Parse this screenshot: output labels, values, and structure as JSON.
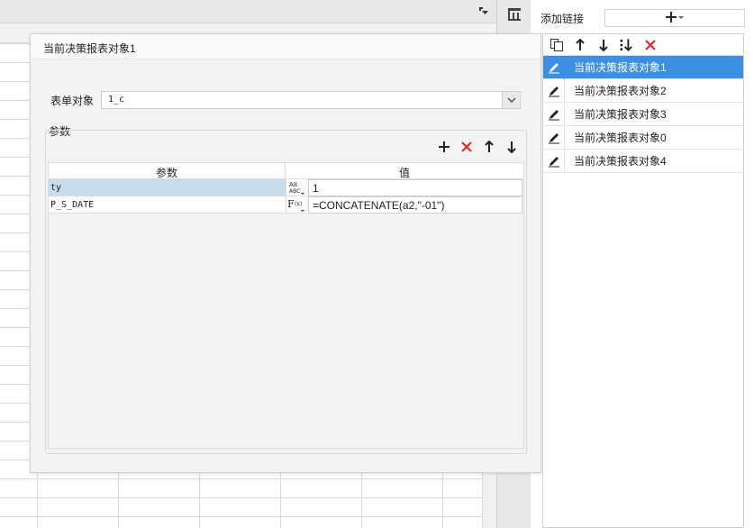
{
  "dialog": {
    "title": "当前决策报表对象1",
    "form_label": "表单对象",
    "form_value": "1_c",
    "group_label": "参数",
    "table": {
      "headers": [
        "参数",
        "值"
      ],
      "rows": [
        {
          "name": "ty",
          "type_icon": "abc-type-icon",
          "type_text": "ABC",
          "value": "1",
          "selected": true
        },
        {
          "name": "P_S_DATE",
          "type_icon": "formula-type-icon",
          "type_text": "F(x)",
          "value": "=CONCATENATE(a2,\"-01\")",
          "selected": false
        }
      ]
    }
  },
  "right_panel": {
    "title": "添加链接",
    "items": [
      {
        "label": "当前决策报表对象1",
        "active": true
      },
      {
        "label": "当前决策报表对象2",
        "active": false
      },
      {
        "label": "当前决策报表对象3",
        "active": false
      },
      {
        "label": "当前决策报表对象0",
        "active": false
      },
      {
        "label": "当前决策报表对象4",
        "active": false
      }
    ]
  },
  "colors": {
    "accent": "#3d8fe4",
    "delete": "#e02a2a",
    "selected_row": "#c9dcec"
  }
}
